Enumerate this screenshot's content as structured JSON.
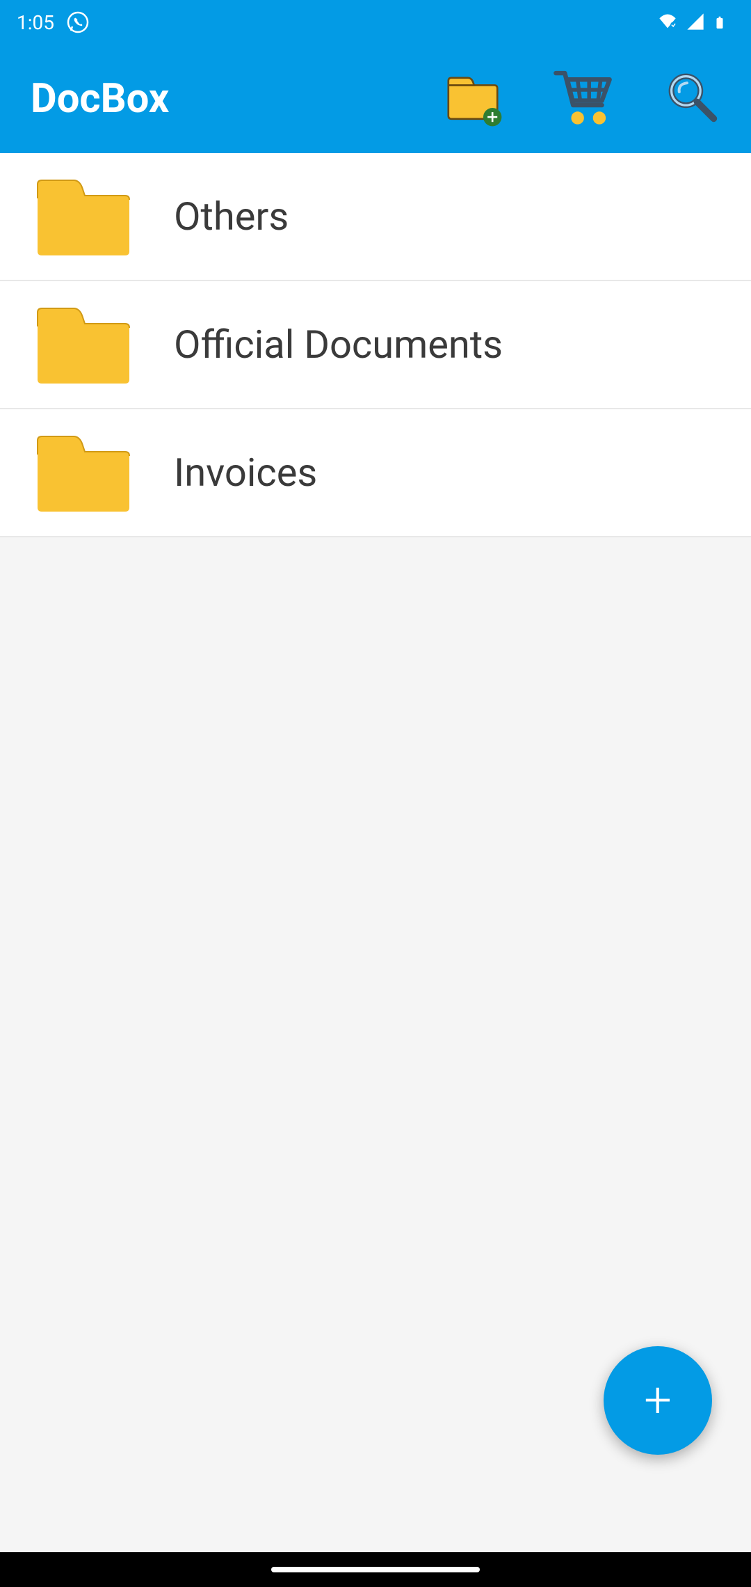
{
  "status": {
    "time": "1:05",
    "icons": {
      "whatsapp": "whatsapp-icon",
      "wifi": "wifi-icon",
      "signal": "signal-icon",
      "battery": "battery-icon"
    }
  },
  "appbar": {
    "title": "DocBox"
  },
  "folders": [
    {
      "name": "Others"
    },
    {
      "name": "Official Documents"
    },
    {
      "name": "Invoices"
    }
  ],
  "fab": {
    "label": "+"
  },
  "colors": {
    "primary": "#039be5",
    "folder_fill": "#f9c232",
    "folder_stroke": "#d19a15",
    "cart_fill": "#f9c232"
  }
}
